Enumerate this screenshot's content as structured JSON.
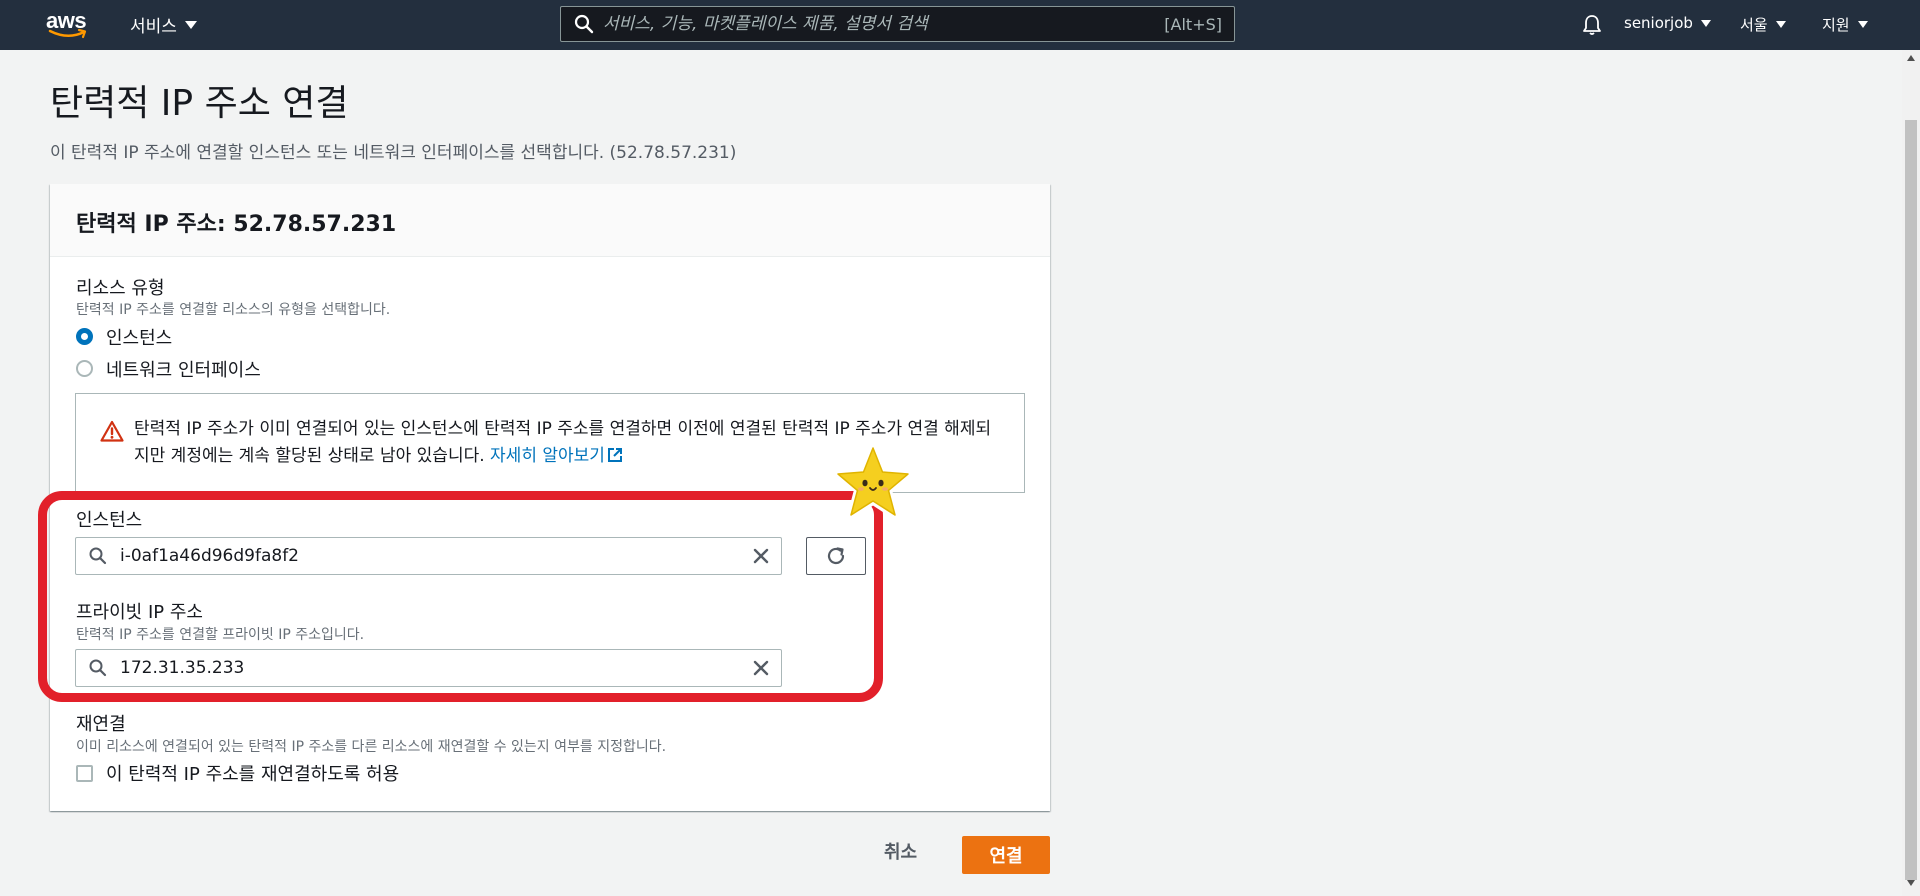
{
  "nav": {
    "logo": "aws",
    "services_label": "서비스",
    "search_placeholder": "서비스, 기능, 마켓플레이스 제품, 설명서 검색",
    "search_shortcut": "[Alt+S]",
    "account": "seniorjob",
    "region": "서울",
    "support": "지원"
  },
  "page": {
    "title": "탄력적 IP 주소 연결",
    "description": "이 탄력적 IP 주소에 연결할 인스턴스 또는 네트워크 인터페이스를 선택합니다. (52.78.57.231)"
  },
  "panel": {
    "header": "탄력적 IP 주소: 52.78.57.231",
    "resource_type": {
      "label": "리소스 유형",
      "description": "탄력적 IP 주소를 연결할 리소스의 유형을 선택합니다.",
      "options": [
        {
          "label": "인스턴스",
          "selected": true
        },
        {
          "label": "네트워크 인터페이스",
          "selected": false
        }
      ]
    },
    "alert": {
      "text": "탄력적 IP 주소가 이미 연결되어 있는 인스턴스에 탄력적 IP 주소를 연결하면 이전에 연결된 탄력적 IP 주소가 연결 해제되지만 계정에는 계속 할당된 상태로 남아 있습니다.",
      "link": "자세히 알아보기"
    },
    "instance": {
      "label": "인스턴스",
      "value": "i-0af1a46d96d9fa8f2"
    },
    "private_ip": {
      "label": "프라이빗 IP 주소",
      "description": "탄력적 IP 주소를 연결할 프라이빗 IP 주소입니다.",
      "value": "172.31.35.233"
    },
    "reassociation": {
      "label": "재연결",
      "description": "이미 리소스에 연결되어 있는 탄력적 IP 주소를 다른 리소스에 재연결할 수 있는지 여부를 지정합니다.",
      "checkbox_label": "이 탄력적 IP 주소를 재연결하도록 허용",
      "checked": false
    }
  },
  "actions": {
    "cancel": "취소",
    "associate": "연결"
  },
  "colors": {
    "nav_bg": "#232f3e",
    "primary": "#ec7211",
    "link": "#0073bb",
    "highlight": "#e2202a",
    "warning": "#d13212"
  }
}
